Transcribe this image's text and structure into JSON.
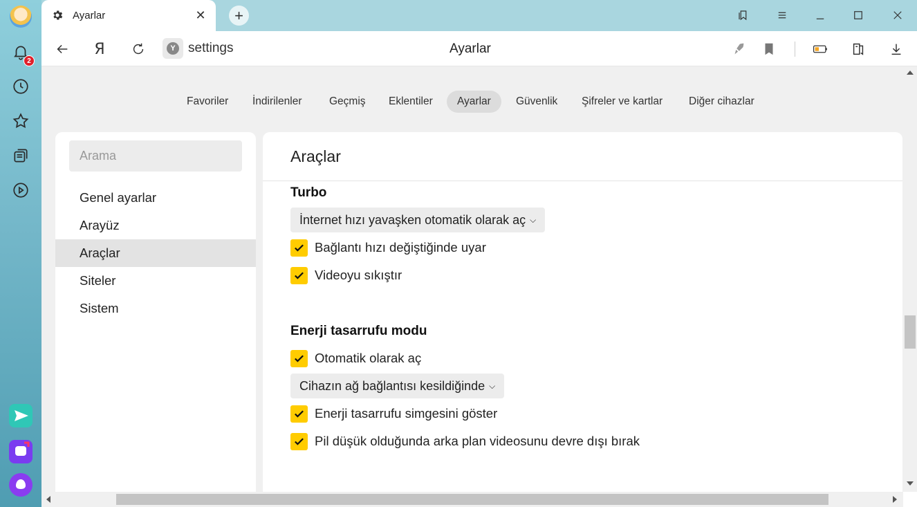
{
  "tab": {
    "title": "Ayarlar",
    "close_label": "✕",
    "new_tab_label": "+"
  },
  "addressbar": {
    "url": "settings",
    "page_title": "Ayarlar",
    "yandex_letter": "Я",
    "site_icon_letter": "Y"
  },
  "notifications": {
    "badge_count": "2"
  },
  "topnav": {
    "items": [
      {
        "label": "Favoriler"
      },
      {
        "label": "İndirilenler"
      },
      {
        "label": "Geçmiş"
      },
      {
        "label": "Eklentiler"
      },
      {
        "label": "Ayarlar",
        "active": true
      },
      {
        "label": "Güvenlik"
      },
      {
        "label": "Şifreler ve kartlar"
      },
      {
        "label": "Diğer cihazlar"
      }
    ]
  },
  "sidebar": {
    "search_placeholder": "Arama",
    "items": [
      {
        "label": "Genel ayarlar"
      },
      {
        "label": "Arayüz"
      },
      {
        "label": "Araçlar",
        "active": true
      },
      {
        "label": "Siteler"
      },
      {
        "label": "Sistem"
      }
    ]
  },
  "section": {
    "title": "Araçlar",
    "turbo": {
      "title": "Turbo",
      "dropdown_value": "İnternet hızı yavaşken otomatik olarak aç",
      "options": [
        {
          "label": "Bağlantı hızı değiştiğinde uyar",
          "checked": true
        },
        {
          "label": "Videoyu sıkıştır",
          "checked": true
        }
      ]
    },
    "energy": {
      "title": "Enerji tasarrufu modu",
      "auto_option": {
        "label": "Otomatik olarak aç",
        "checked": true
      },
      "dropdown_value": "Cihazın ağ bağlantısı kesildiğinde",
      "options": [
        {
          "label": "Enerji tasarrufu simgesini göster",
          "checked": true
        },
        {
          "label": "Pil düşük olduğunda arka plan videosunu devre dışı bırak",
          "checked": true
        }
      ]
    }
  },
  "colors": {
    "accent_checkbox": "#ffcc00",
    "sidebar_top": "#8fcfdc",
    "sidebar_bottom": "#4f9db2"
  }
}
